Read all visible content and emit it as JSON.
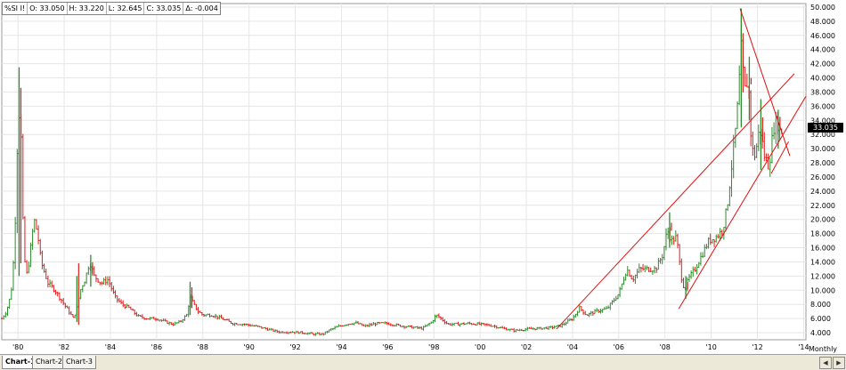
{
  "header": {
    "symbol": "%SI I!",
    "open": "O: 33.050",
    "high": "H: 33.220",
    "low": "L: 32.645",
    "close": "C: 33.035",
    "delta": "Δ: -0.004"
  },
  "last_price_label": "33.035",
  "period_label": "Monthly",
  "tabs": [
    "Chart-1",
    "Chart-2",
    "Chart-3"
  ],
  "colors": {
    "up": "#2e8b2e",
    "down": "#dd1b1b",
    "trendline": "#e01010",
    "grid": "#e6e6e6",
    "last_price_bg": "#000000"
  },
  "chart_data": {
    "type": "candlestick",
    "title": "",
    "xlabel": "",
    "ylabel": "",
    "x_range": [
      1979.3,
      2014.1
    ],
    "ylim": [
      3.0,
      50.5
    ],
    "grid": true,
    "y_axis_side": "right",
    "y_ticks": [
      "4.000",
      "6.000",
      "8.000",
      "10.000",
      "12.000",
      "14.000",
      "16.000",
      "18.000",
      "20.000",
      "22.000",
      "24.000",
      "26.000",
      "28.000",
      "30.000",
      "32.000",
      "34.000",
      "36.000",
      "38.000",
      "40.000",
      "42.000",
      "44.000",
      "46.000",
      "48.000",
      "50.000"
    ],
    "x_ticks": [
      "'80",
      "'82",
      "'84",
      "'86",
      "'88",
      "'90",
      "'92",
      "'94",
      "'96",
      "'98",
      "'00",
      "'02",
      "'04",
      "'06",
      "'08",
      "'10",
      "'12",
      "'14"
    ],
    "price_path": [
      [
        1979.3,
        6.0
      ],
      [
        1979.5,
        7.0
      ],
      [
        1979.7,
        9.5
      ],
      [
        1979.85,
        16.0
      ],
      [
        1980.0,
        34.0
      ],
      [
        1980.1,
        36.0
      ],
      [
        1980.25,
        15.0
      ],
      [
        1980.4,
        12.0
      ],
      [
        1980.55,
        16.0
      ],
      [
        1980.7,
        20.0
      ],
      [
        1980.85,
        18.0
      ],
      [
        1981.0,
        14.0
      ],
      [
        1981.3,
        11.0
      ],
      [
        1981.6,
        10.0
      ],
      [
        1981.9,
        8.5
      ],
      [
        1982.2,
        7.0
      ],
      [
        1982.4,
        6.0
      ],
      [
        1982.55,
        7.5
      ],
      [
        1982.7,
        10.0
      ],
      [
        1982.9,
        11.5
      ],
      [
        1983.1,
        14.0
      ],
      [
        1983.3,
        12.0
      ],
      [
        1983.6,
        11.0
      ],
      [
        1983.9,
        11.5
      ],
      [
        1984.2,
        9.0
      ],
      [
        1984.5,
        8.0
      ],
      [
        1984.8,
        7.5
      ],
      [
        1985.2,
        6.3
      ],
      [
        1985.6,
        6.0
      ],
      [
        1986.0,
        6.0
      ],
      [
        1986.4,
        5.5
      ],
      [
        1986.7,
        5.2
      ],
      [
        1987.0,
        5.5
      ],
      [
        1987.3,
        6.5
      ],
      [
        1987.45,
        9.0
      ],
      [
        1987.6,
        8.0
      ],
      [
        1987.8,
        7.0
      ],
      [
        1988.0,
        6.5
      ],
      [
        1988.4,
        6.5
      ],
      [
        1988.8,
        6.0
      ],
      [
        1989.3,
        5.3
      ],
      [
        1989.8,
        5.2
      ],
      [
        1990.3,
        4.9
      ],
      [
        1990.8,
        4.5
      ],
      [
        1991.3,
        4.1
      ],
      [
        1991.8,
        4.1
      ],
      [
        1992.3,
        4.0
      ],
      [
        1992.8,
        3.8
      ],
      [
        1993.2,
        3.8
      ],
      [
        1993.5,
        4.4
      ],
      [
        1993.8,
        4.8
      ],
      [
        1994.2,
        5.2
      ],
      [
        1994.6,
        5.4
      ],
      [
        1995.0,
        4.9
      ],
      [
        1995.5,
        5.3
      ],
      [
        1996.0,
        5.3
      ],
      [
        1996.5,
        5.0
      ],
      [
        1997.0,
        4.8
      ],
      [
        1997.5,
        4.6
      ],
      [
        1997.9,
        5.5
      ],
      [
        1998.1,
        6.5
      ],
      [
        1998.3,
        6.0
      ],
      [
        1998.6,
        5.2
      ],
      [
        1999.0,
        5.2
      ],
      [
        1999.5,
        5.3
      ],
      [
        2000.0,
        5.2
      ],
      [
        2000.5,
        5.0
      ],
      [
        2001.0,
        4.6
      ],
      [
        2001.5,
        4.3
      ],
      [
        2002.0,
        4.5
      ],
      [
        2002.5,
        4.6
      ],
      [
        2003.0,
        4.7
      ],
      [
        2003.5,
        5.0
      ],
      [
        2004.0,
        6.0
      ],
      [
        2004.3,
        7.5
      ],
      [
        2004.6,
        6.5
      ],
      [
        2005.0,
        7.0
      ],
      [
        2005.5,
        7.4
      ],
      [
        2006.0,
        9.5
      ],
      [
        2006.35,
        13.0
      ],
      [
        2006.6,
        11.5
      ],
      [
        2006.9,
        13.0
      ],
      [
        2007.2,
        13.0
      ],
      [
        2007.6,
        13.0
      ],
      [
        2007.9,
        15.0
      ],
      [
        2008.1,
        18.5
      ],
      [
        2008.3,
        17.0
      ],
      [
        2008.5,
        17.5
      ],
      [
        2008.7,
        12.0
      ],
      [
        2008.85,
        10.0
      ],
      [
        2009.0,
        11.5
      ],
      [
        2009.3,
        13.0
      ],
      [
        2009.6,
        15.0
      ],
      [
        2009.9,
        17.0
      ],
      [
        2010.2,
        17.5
      ],
      [
        2010.5,
        18.5
      ],
      [
        2010.7,
        22.0
      ],
      [
        2010.9,
        28.0
      ],
      [
        2011.1,
        34.0
      ],
      [
        2011.3,
        44.0
      ],
      [
        2011.45,
        38.0
      ],
      [
        2011.6,
        40.0
      ],
      [
        2011.75,
        30.0
      ],
      [
        2011.9,
        29.0
      ],
      [
        2012.1,
        33.0
      ],
      [
        2012.3,
        29.0
      ],
      [
        2012.5,
        27.5
      ],
      [
        2012.7,
        33.0
      ],
      [
        2012.85,
        34.0
      ],
      [
        2013.0,
        32.0
      ],
      [
        2013.1,
        33.035
      ]
    ],
    "spikes": [
      [
        1980.05,
        41.5,
        12.0
      ],
      [
        1982.55,
        5.5,
        12.0
      ],
      [
        1983.15,
        15.0,
        10.5
      ],
      [
        1987.45,
        11.2,
        6.5
      ],
      [
        2008.2,
        21.0,
        16.0
      ],
      [
        2008.9,
        12.0,
        8.8
      ],
      [
        2011.3,
        49.8,
        33.0
      ],
      [
        2011.65,
        43.0,
        34.0
      ],
      [
        2012.15,
        37.0,
        27.0
      ],
      [
        2012.9,
        35.5,
        30.0
      ]
    ],
    "trendlines": [
      {
        "from": [
          2003.3,
          4.5
        ],
        "to": [
          2013.6,
          40.6
        ]
      },
      {
        "from": [
          2008.6,
          7.4
        ],
        "to": [
          2014.1,
          37.4
        ]
      },
      {
        "from": [
          2011.25,
          49.8
        ],
        "to": [
          2013.4,
          29.0
        ]
      },
      {
        "from": [
          2012.6,
          26.5
        ],
        "to": [
          2013.35,
          31.0
        ]
      }
    ]
  }
}
